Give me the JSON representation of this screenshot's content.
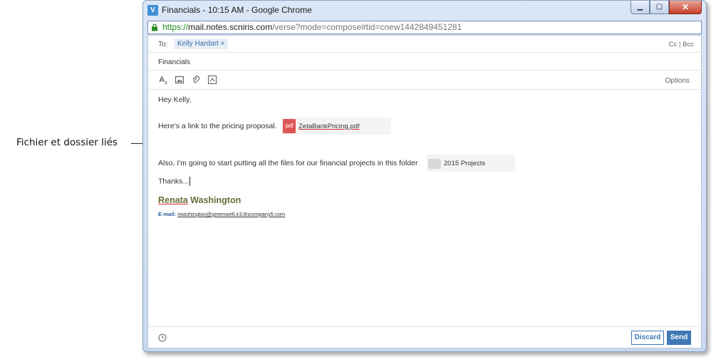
{
  "annotation": {
    "label": "Fichier et dossier liés"
  },
  "window": {
    "title": "Financials - 10:15 AM - Google Chrome",
    "controls": {
      "minimize": "▁",
      "maximize": "▢",
      "close": "✕"
    }
  },
  "address_bar": {
    "scheme": "https://",
    "host": "mail.notes.scniris.com",
    "path": "/verse?mode=compose#tid=cnew1442849451281"
  },
  "compose": {
    "to_label": "To:",
    "recipient": "Kelly Hardart",
    "recipient_remove": "×",
    "cc_bcc": "Cc | Bcc",
    "subject": "Financials",
    "options_label": "Options",
    "greeting": "Hey Kelly,",
    "line1": "Here's a link to the pricing proposal.",
    "attachment_file": {
      "icon_text": "pdf",
      "name": "ZetaBankPricing.pdf"
    },
    "line2": "Also, I'm going to start putting all the files for our financial projects in this folder",
    "attachment_folder": {
      "name": "2015 Projects"
    },
    "closing": "Thanks...",
    "signature": {
      "first_name": "Renata",
      "last_name": "Washington",
      "email_label": "E-mail:",
      "email": "rwashington@greenwell.ir3.llncompany5.com"
    }
  },
  "footer": {
    "discard_label": "Discard",
    "send_label": "Send"
  },
  "colors": {
    "accent": "#3f78b5",
    "pdf": "#e05555",
    "url_host": "#1e8a1e"
  }
}
